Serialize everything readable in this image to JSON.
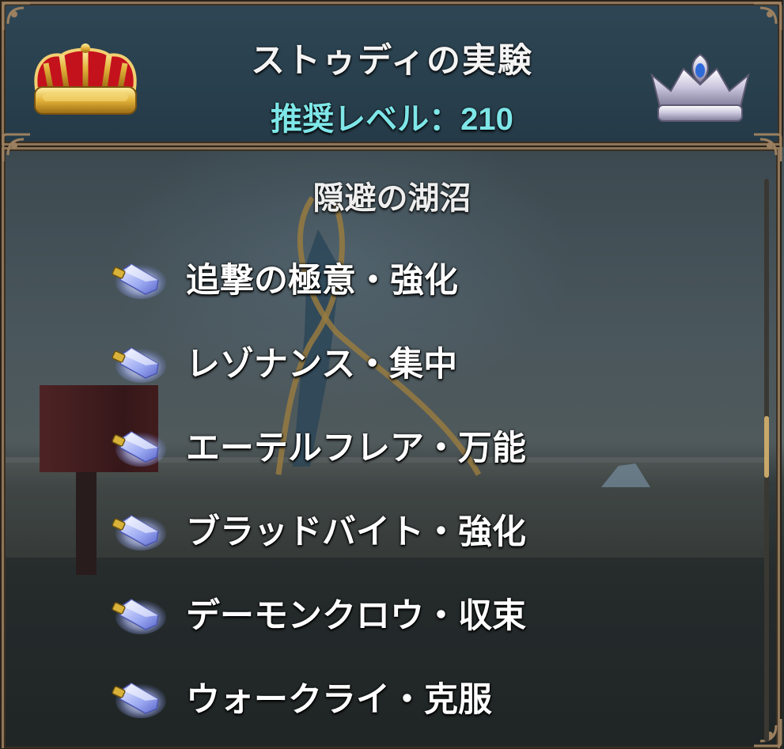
{
  "header": {
    "title": "ストゥディの実験",
    "level_label": "推奨レベル：",
    "level_value": "210"
  },
  "section": {
    "title": "隠避の湖沼"
  },
  "skills": [
    {
      "label": "追撃の極意・強化",
      "icon": "blue-crystal-gem-icon"
    },
    {
      "label": "レゾナンス・集中",
      "icon": "blue-crystal-gem-icon"
    },
    {
      "label": "エーテルフレア・万能",
      "icon": "blue-crystal-gem-icon"
    },
    {
      "label": "ブラッドバイト・強化",
      "icon": "blue-crystal-gem-icon"
    },
    {
      "label": "デーモンクロウ・収束",
      "icon": "blue-crystal-gem-icon"
    },
    {
      "label": "ウォークライ・克服",
      "icon": "blue-crystal-gem-icon"
    }
  ],
  "icons": {
    "left_crown": "gold-crown-icon",
    "right_crown": "silver-crown-icon"
  },
  "colors": {
    "title": "#f4f4f4",
    "level": "#7ee6e8",
    "frame": "#8d7558",
    "scroll_thumb": "#c9a86a"
  }
}
